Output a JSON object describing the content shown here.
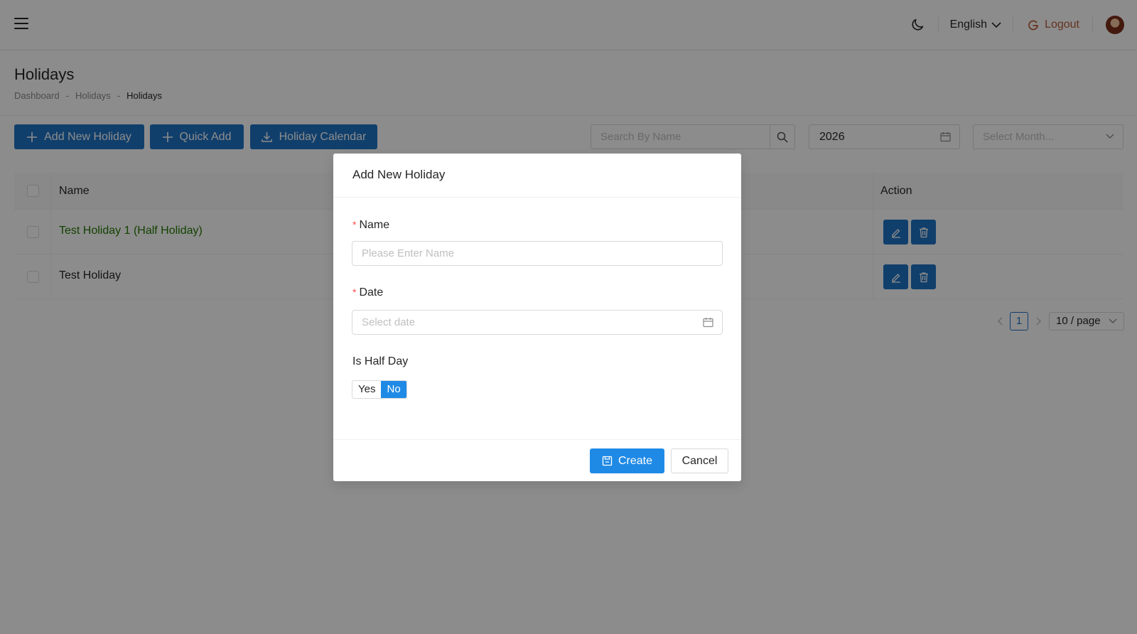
{
  "header": {
    "language": "English",
    "logout_label": "Logout"
  },
  "page": {
    "title": "Holidays",
    "breadcrumb": [
      "Dashboard",
      "Holidays",
      "Holidays"
    ]
  },
  "toolbar": {
    "add_new_label": "Add New Holiday",
    "quick_add_label": "Quick Add",
    "calendar_label": "Holiday Calendar",
    "search_placeholder": "Search By Name",
    "year_value": "2026",
    "month_placeholder": "Select Month..."
  },
  "table": {
    "columns": {
      "name": "Name",
      "action": "Action"
    },
    "rows": [
      {
        "name": "Test Holiday 1 (Half Holiday)",
        "name_color": "#237804"
      },
      {
        "name": "Test Holiday",
        "name_color": "#262626"
      }
    ]
  },
  "pagination": {
    "current_page": "1",
    "page_size": "10 / page"
  },
  "modal": {
    "title": "Add New Holiday",
    "name_label": "Name",
    "name_placeholder": "Please Enter Name",
    "date_label": "Date",
    "date_placeholder": "Select date",
    "half_day_label": "Is Half Day",
    "half_day_options": [
      "Yes",
      "No"
    ],
    "half_day_selected": "No",
    "create_label": "Create",
    "cancel_label": "Cancel",
    "required_mark": "*"
  },
  "colors": {
    "primary": "#1f74c5",
    "accent": "#1f8ae6",
    "logout": "#b85c38",
    "required": "#ff4d4f"
  }
}
